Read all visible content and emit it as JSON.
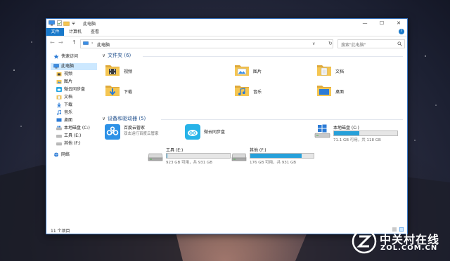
{
  "window": {
    "title": "此电脑",
    "buttons": {
      "minimize": "—",
      "maximize": "☐",
      "close": "✕"
    }
  },
  "ribbon": {
    "file": "文件",
    "tabs": [
      "计算机",
      "查看"
    ],
    "help": "?"
  },
  "address": {
    "back": "←",
    "forward": "→",
    "up": "↑",
    "separator": "›",
    "path": "此电脑",
    "dropdown": "∨",
    "refresh": "↻"
  },
  "search": {
    "placeholder": "搜索\"此电脑\"",
    "icon": "search-icon"
  },
  "nav": {
    "items": [
      {
        "label": "快速访问",
        "icon": "star-icon"
      },
      {
        "label": "此电脑",
        "icon": "computer-icon",
        "selected": true
      },
      {
        "label": "视频",
        "icon": "video-folder-icon"
      },
      {
        "label": "图片",
        "icon": "picture-folder-icon"
      },
      {
        "label": "微云同步盘",
        "icon": "cloud-sync-icon"
      },
      {
        "label": "文档",
        "icon": "document-folder-icon"
      },
      {
        "label": "下载",
        "icon": "download-icon"
      },
      {
        "label": "音乐",
        "icon": "music-icon"
      },
      {
        "label": "桌面",
        "icon": "desktop-icon"
      },
      {
        "label": "本地磁盘 (C:)",
        "icon": "drive-icon"
      },
      {
        "label": "工具 (E:)",
        "icon": "drive-icon"
      },
      {
        "label": "其他 (F:)",
        "icon": "drive-icon"
      },
      {
        "label": "网络",
        "icon": "network-icon"
      }
    ]
  },
  "folders": {
    "header": "文件夹 (6)",
    "items": [
      {
        "name": "视频",
        "icon": "video-folder-icon"
      },
      {
        "name": "图片",
        "icon": "picture-folder-icon"
      },
      {
        "name": "文档",
        "icon": "document-folder-icon"
      },
      {
        "name": "下载",
        "icon": "download-folder-icon"
      },
      {
        "name": "音乐",
        "icon": "music-folder-icon"
      },
      {
        "name": "桌面",
        "icon": "desktop-folder-icon"
      }
    ]
  },
  "devices": {
    "header": "设备和驱动器 (5)",
    "apps": [
      {
        "name": "百度云管家",
        "desc": "双击运行百度云管家",
        "icon": "baidu-cloud-icon"
      },
      {
        "name": "微云同步盘",
        "icon": "weiyun-icon"
      }
    ],
    "drives": [
      {
        "name": "本地磁盘 (C:)",
        "free": "71.1 GB 可用，共 118 GB",
        "used_fraction": 0.4,
        "icon": "windows-drive-icon"
      },
      {
        "name": "工具 (E:)",
        "free": "923 GB 可用，共 931 GB",
        "used_fraction": 0.01,
        "icon": "drive-icon"
      },
      {
        "name": "其他 (F:)",
        "free": "176 GB 可用，共 931 GB",
        "used_fraction": 0.81,
        "icon": "drive-icon"
      }
    ]
  },
  "status": {
    "items_count": "11 个项目"
  },
  "watermark": {
    "cn": "中关村在线",
    "en": "ZOL.COM.CN"
  },
  "colors": {
    "accent": "#1979ca",
    "selection": "#cce8ff",
    "drive_fill": "#26a0da",
    "folder": "#f5c652"
  }
}
